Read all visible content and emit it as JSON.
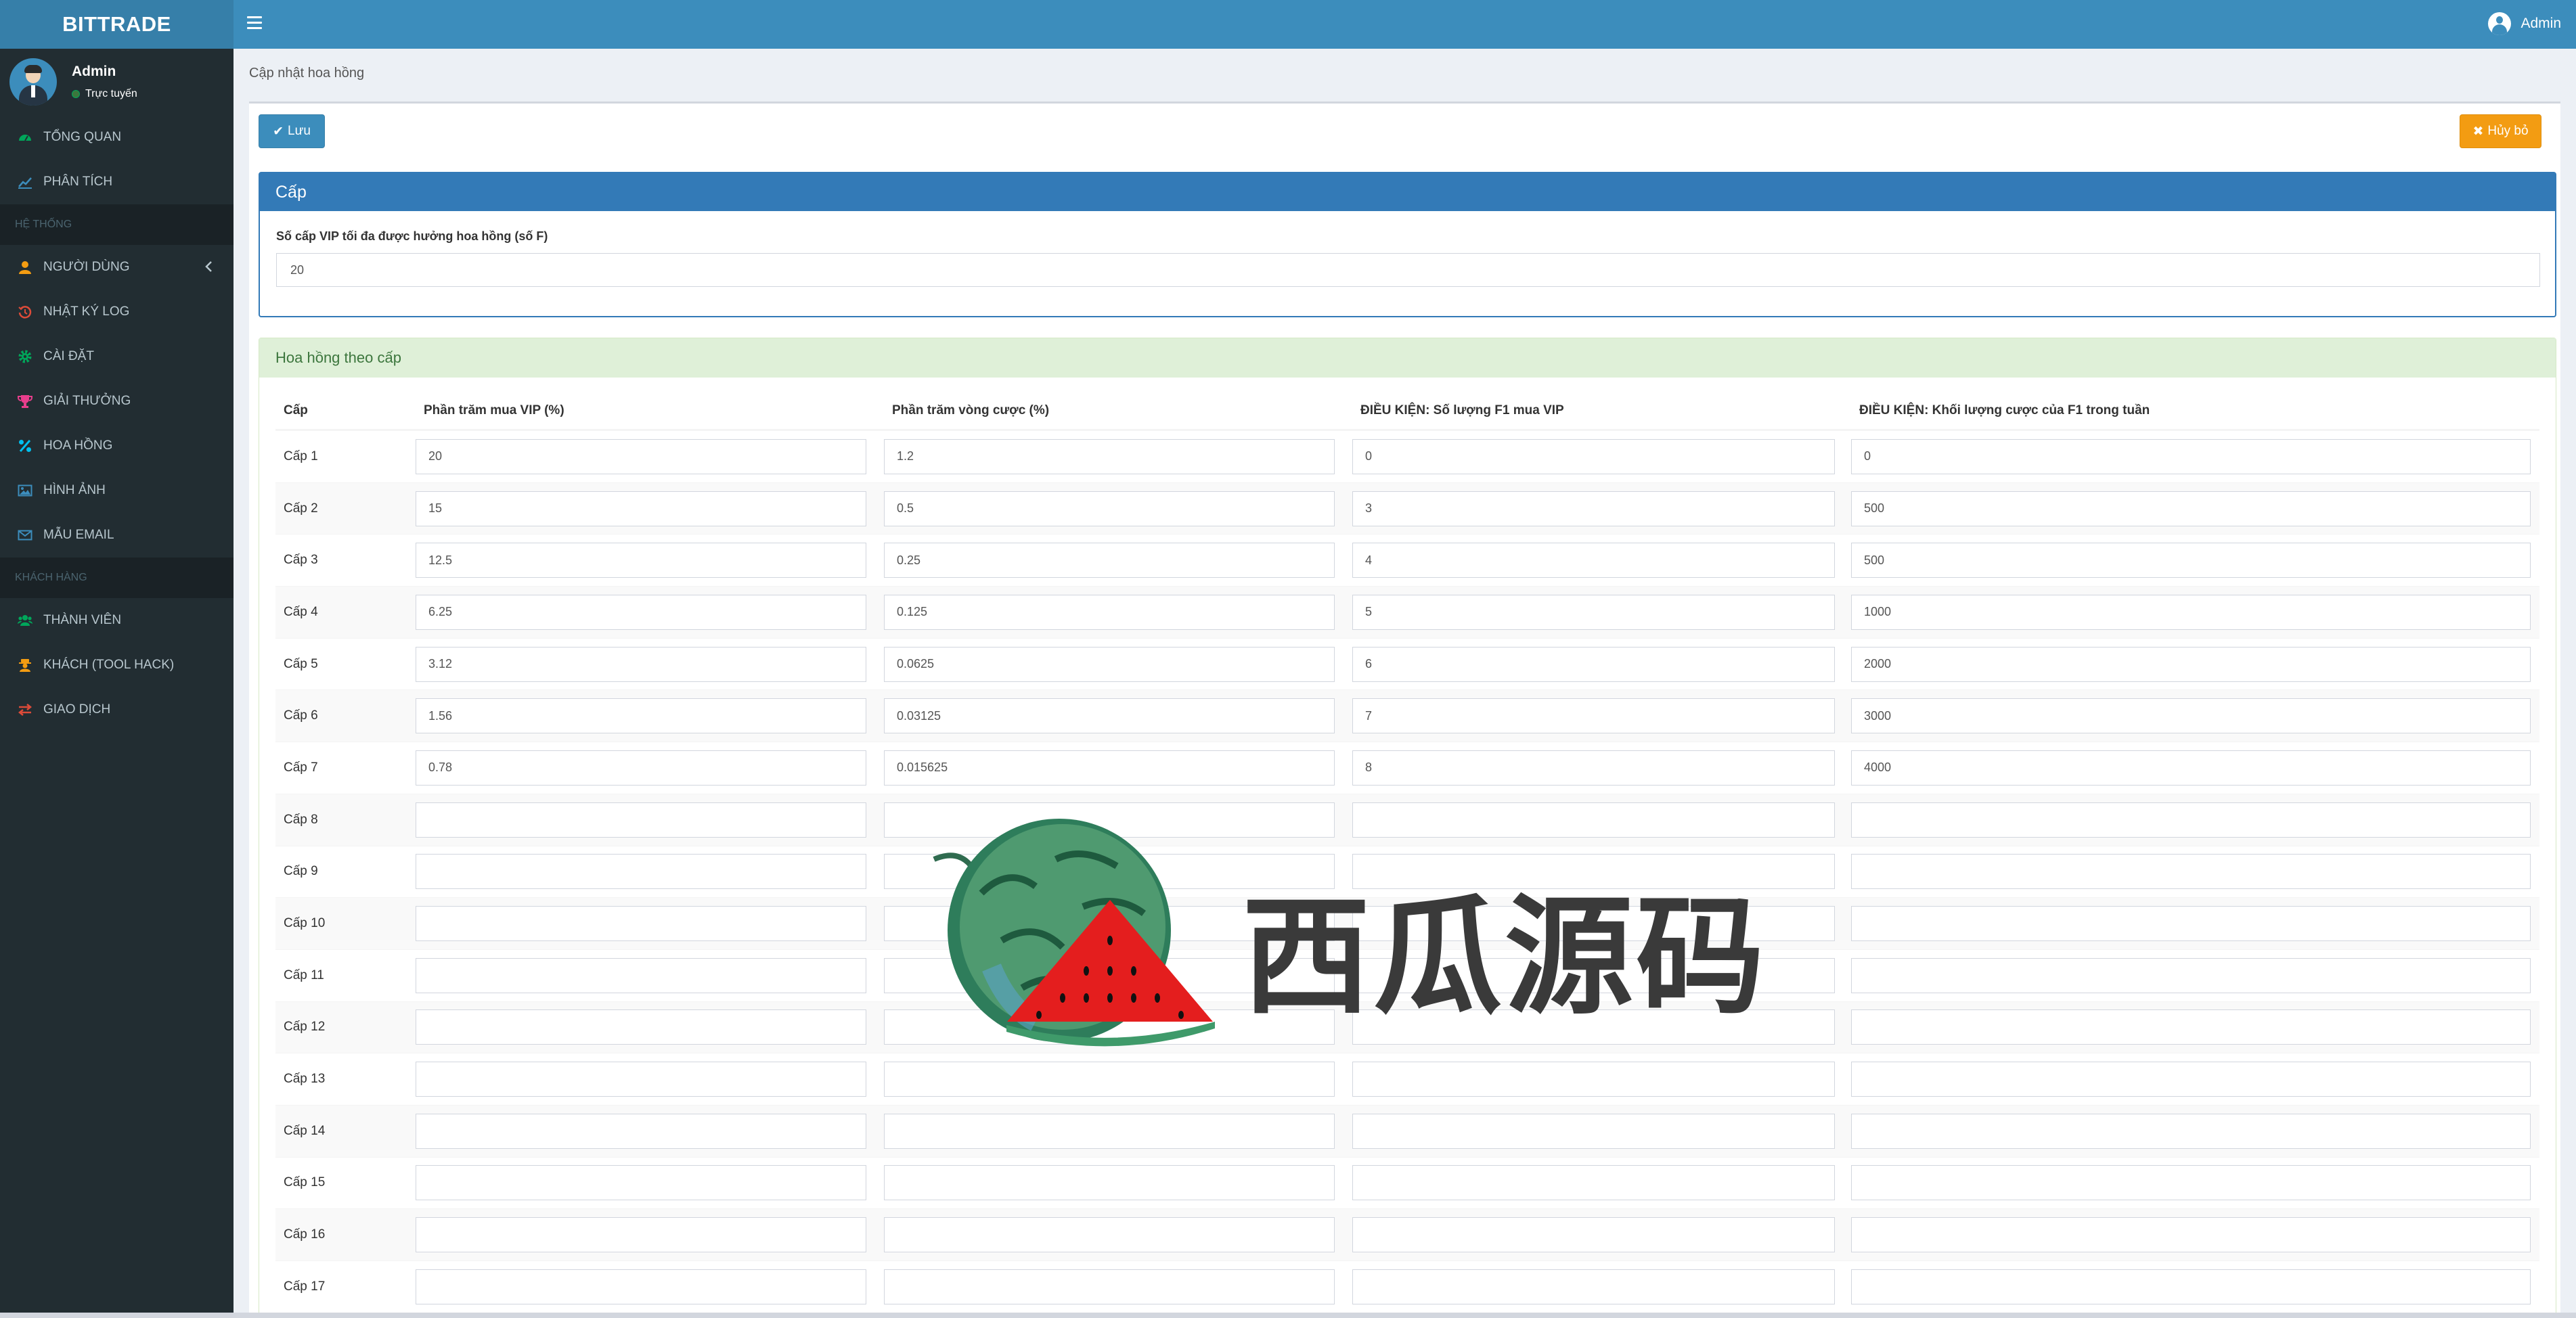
{
  "sidebar": {
    "logo": "BITTRADE",
    "user": {
      "name": "Admin",
      "status": "Trực tuyến"
    },
    "items": [
      {
        "label": "TỔNG QUAN",
        "icon": "dashboard-icon",
        "color": "#00a65a"
      },
      {
        "label": "PHÂN TÍCH",
        "icon": "line-chart-icon",
        "color": "#3c8dbc"
      },
      {
        "header": "HỆ THỐNG"
      },
      {
        "label": "NGƯỜI DÙNG",
        "icon": "user-icon",
        "color": "#f39c12"
      },
      {
        "label": "NHẬT KÝ LOG",
        "icon": "history-icon",
        "color": "#dd4b39"
      },
      {
        "label": "CÀI ĐẶT",
        "icon": "gear-icon",
        "color": "#00a65a"
      },
      {
        "label": "GIẢI THƯỞNG",
        "icon": "trophy-icon",
        "color": "#e83e8c"
      },
      {
        "label": "HOA HỒNG",
        "icon": "percent-icon",
        "color": "#00c0ef"
      },
      {
        "label": "HÌNH ẢNH",
        "icon": "image-icon",
        "color": "#3c8dbc"
      },
      {
        "label": "MẪU EMAIL",
        "icon": "envelope-icon",
        "color": "#3c8dbc"
      },
      {
        "header": "KHÁCH HÀNG"
      },
      {
        "label": "THÀNH VIÊN",
        "icon": "users-icon",
        "color": "#00a65a"
      },
      {
        "label": "KHÁCH (TOOL HACK)",
        "icon": "user-secret-icon",
        "color": "#f39c12"
      },
      {
        "label": "GIAO DỊCH",
        "icon": "exchange-icon",
        "color": "#dd4b39"
      }
    ]
  },
  "topbar": {
    "user_name": "Admin"
  },
  "breadcrumb": "Cập nhật hoa hồng",
  "actions": {
    "save_label": "Lưu",
    "cancel_label": "Hủy bỏ"
  },
  "level_panel": {
    "title": "Cấp",
    "field_label": "Số cấp VIP tối đa được hưởng hoa hồng (số F)",
    "field_value": "20"
  },
  "commission_panel": {
    "title": "Hoa hồng theo cấp",
    "columns": [
      "Cấp",
      "Phần trăm mua VIP (%)",
      "Phần trăm vòng cược (%)",
      "ĐIỀU KIỆN: Số lượng F1 mua VIP",
      "ĐIỀU KIỆN: Khối lượng cược của F1 trong tuần"
    ],
    "rows": [
      {
        "level": "Cấp 1",
        "vip": "20",
        "bet": "1.2",
        "f1_count": "0",
        "f1_volume": "0"
      },
      {
        "level": "Cấp 2",
        "vip": "15",
        "bet": "0.5",
        "f1_count": "3",
        "f1_volume": "500"
      },
      {
        "level": "Cấp 3",
        "vip": "12.5",
        "bet": "0.25",
        "f1_count": "4",
        "f1_volume": "500"
      },
      {
        "level": "Cấp 4",
        "vip": "6.25",
        "bet": "0.125",
        "f1_count": "5",
        "f1_volume": "1000"
      },
      {
        "level": "Cấp 5",
        "vip": "3.12",
        "bet": "0.0625",
        "f1_count": "6",
        "f1_volume": "2000"
      },
      {
        "level": "Cấp 6",
        "vip": "1.56",
        "bet": "0.03125",
        "f1_count": "7",
        "f1_volume": "3000"
      },
      {
        "level": "Cấp 7",
        "vip": "0.78",
        "bet": "0.015625",
        "f1_count": "8",
        "f1_volume": "4000"
      },
      {
        "level": "Cấp 8",
        "vip": "",
        "bet": "",
        "f1_count": "",
        "f1_volume": ""
      },
      {
        "level": "Cấp 9",
        "vip": "",
        "bet": "",
        "f1_count": "",
        "f1_volume": ""
      },
      {
        "level": "Cấp 10",
        "vip": "",
        "bet": "",
        "f1_count": "",
        "f1_volume": ""
      },
      {
        "level": "Cấp 11",
        "vip": "",
        "bet": "",
        "f1_count": "",
        "f1_volume": ""
      },
      {
        "level": "Cấp 12",
        "vip": "",
        "bet": "",
        "f1_count": "",
        "f1_volume": ""
      },
      {
        "level": "Cấp 13",
        "vip": "",
        "bet": "",
        "f1_count": "",
        "f1_volume": ""
      },
      {
        "level": "Cấp 14",
        "vip": "",
        "bet": "",
        "f1_count": "",
        "f1_volume": ""
      },
      {
        "level": "Cấp 15",
        "vip": "",
        "bet": "",
        "f1_count": "",
        "f1_volume": ""
      },
      {
        "level": "Cấp 16",
        "vip": "",
        "bet": "",
        "f1_count": "",
        "f1_volume": ""
      },
      {
        "level": "Cấp 17",
        "vip": "",
        "bet": "",
        "f1_count": "",
        "f1_volume": ""
      }
    ]
  },
  "watermark": {
    "text": "西瓜源码"
  },
  "colors": {
    "brand": "#3c8dbc",
    "brand_dark": "#367fa9",
    "sidebar": "#222d32",
    "primary": "#337ab7",
    "warning": "#f39c12",
    "success_bg": "#dff0d8"
  }
}
